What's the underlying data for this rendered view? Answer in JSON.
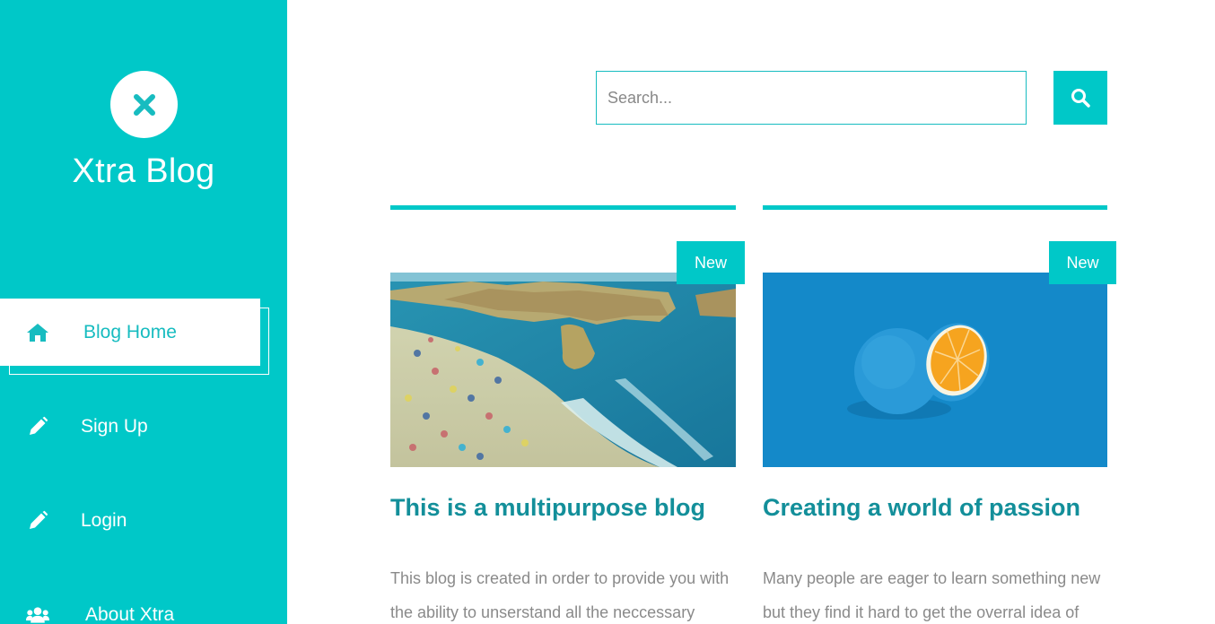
{
  "sidebar": {
    "site_title": "Xtra Blog",
    "logo_icon": "close-x-icon",
    "items": [
      {
        "label": "Blog Home",
        "icon": "home-icon",
        "active": true
      },
      {
        "label": "Sign Up",
        "icon": "pencil-icon"
      },
      {
        "label": "Login",
        "icon": "pencil-icon"
      },
      {
        "label": "About Xtra",
        "icon": "users-icon"
      }
    ]
  },
  "search": {
    "placeholder": "Search...",
    "value": "",
    "button_icon": "search-icon"
  },
  "posts": [
    {
      "badge": "New",
      "title": "This is a multipurpose blog",
      "excerpt": "This blog is created in order to provide you with the ability to unserstand all the neccessary",
      "image": "beach-image"
    },
    {
      "badge": "New",
      "title": "Creating a world of passion",
      "excerpt": "Many people are eager to learn something new but they find it hard to get the overral idea of",
      "image": "orange-image"
    }
  ],
  "colors": {
    "accent": "#00c8c8",
    "title_text": "#138f9a",
    "body_text": "#8a8a8a"
  }
}
